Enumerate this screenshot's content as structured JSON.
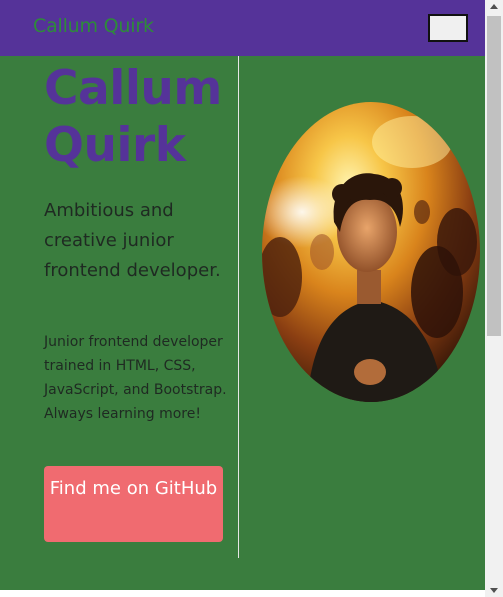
{
  "navbar": {
    "brand": "Callum Quirk",
    "toggler_icon": "hamburger-icon"
  },
  "hero": {
    "name": "Callum Quirk",
    "tagline": "Ambitious and creative junior frontend developer.",
    "bio": "Junior frontend developer trained in HTML, CSS, JavaScript, and Bootstrap. Always learning more!",
    "cta_label": "Find me on GitHub",
    "photo_alt": "Portrait photo"
  },
  "colors": {
    "navbar_bg": "#553399",
    "brand_text": "#2e8b3a",
    "hero_bg": "#3a7d3e",
    "name_text": "#553399",
    "cta_bg": "#f06b70",
    "cta_text": "#ffffff"
  }
}
